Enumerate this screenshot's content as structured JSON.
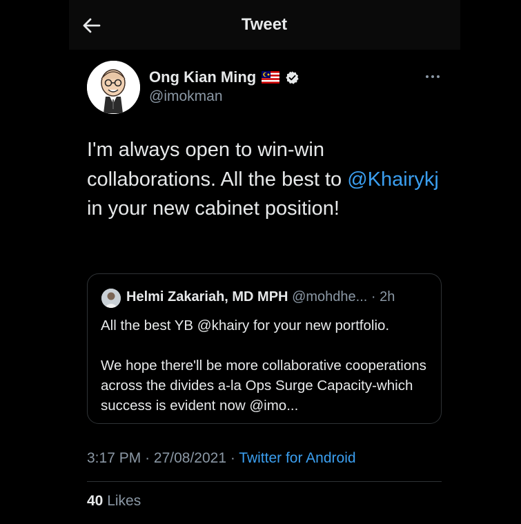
{
  "header": {
    "title": "Tweet",
    "back_icon": "arrow-left-icon"
  },
  "author": {
    "name": "Ong Kian Ming",
    "handle": "@imokman",
    "flag_icon": "malaysia-flag-icon",
    "verified_icon": "verified-badge-icon"
  },
  "tweet": {
    "text_before": "I'm always open to win-win collaborations. All the best to ",
    "mention": "@Khairykj",
    "text_after": " in your new cabinet position!"
  },
  "quote": {
    "name": "Helmi Zakariah, MD MPH",
    "handle": "@mohdhe...",
    "time": "· 2h",
    "line1": "All the best YB @khairy for your new portfolio.",
    "line2": "We hope there'll be more collaborative cooperations across the divides a-la Ops Surge Capacity-which success is evident now @imo..."
  },
  "meta": {
    "time": "3:17 PM",
    "date": "· 27/08/2021 ·",
    "source": "Twitter for Android"
  },
  "stats": {
    "likes_count": "40",
    "likes_label": "Likes"
  },
  "colors": {
    "background": "#000000",
    "link": "#3b9ff0",
    "secondary": "#8b98a5"
  }
}
